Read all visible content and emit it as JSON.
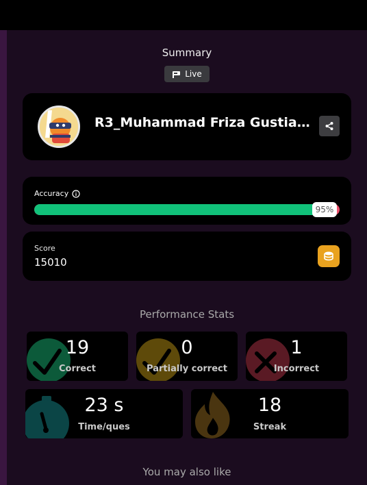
{
  "header": {
    "title": "Summary",
    "mode_badge": "Live"
  },
  "player": {
    "name": "R3_Muhammad Friza Gustiadi Pr...",
    "avatar_icon": "ninja-avatar-icon"
  },
  "accuracy": {
    "label": "Accuracy",
    "percent_text": "95%",
    "percent": 95,
    "fill_color": "#11c27a",
    "rest_color": "#ec4f6a"
  },
  "score": {
    "label": "Score",
    "value": "15010"
  },
  "performance": {
    "title": "Performance Stats",
    "stats": [
      {
        "value": "19",
        "label": "Correct",
        "icon": "check-circle-icon",
        "color": "#0c5a3a"
      },
      {
        "value": "0",
        "label": "Partially correct",
        "icon": "check-circle-icon",
        "color": "#5e4a0a"
      },
      {
        "value": "1",
        "label": "Incorrect",
        "icon": "x-circle-icon",
        "color": "#5a1a24"
      },
      {
        "value": "23 s",
        "label": "Time/ques",
        "icon": "stopwatch-icon",
        "color": "#0b4546"
      },
      {
        "value": "18",
        "label": "Streak",
        "icon": "flame-icon",
        "color": "#4a3510"
      }
    ]
  },
  "recommendations": {
    "title": "You may also like"
  }
}
